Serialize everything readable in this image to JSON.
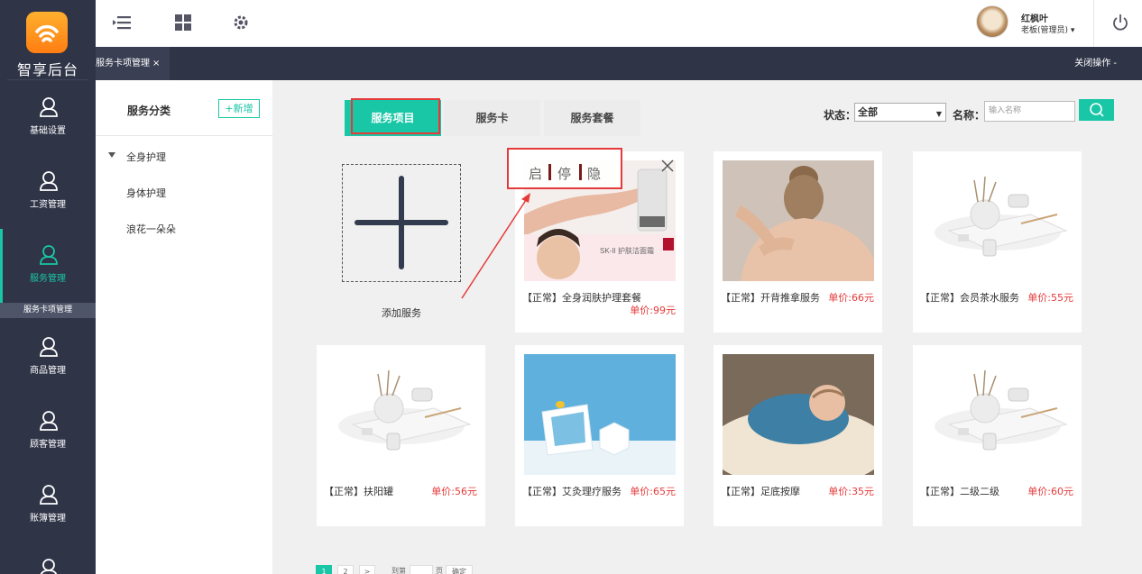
{
  "app": {
    "logo_text": "智享后台"
  },
  "nav": {
    "items": [
      {
        "label": "基础设置"
      },
      {
        "label": "工资管理"
      },
      {
        "label": "服务管理"
      },
      {
        "label": "商品管理"
      },
      {
        "label": "顾客管理"
      },
      {
        "label": "账簿管理"
      }
    ],
    "sub_label": "服务卡项管理"
  },
  "topbar": {
    "user_name": "红枫叶",
    "user_role": "老板(管理员) ▾"
  },
  "tabbar": {
    "tab_label": "服务卡项管理",
    "tab_close": "×",
    "close_ops": "关闭操作 -"
  },
  "category": {
    "title": "服务分类",
    "add_label": "+新增",
    "items": [
      "全身护理",
      "身体护理",
      "浪花一朵朵"
    ]
  },
  "tabs": [
    "服务项目",
    "服务卡",
    "服务套餐"
  ],
  "filters": {
    "status_label": "状态：",
    "status_value": "全部",
    "name_label": "名称：",
    "name_placeholder": "输入名称"
  },
  "add_service_label": "添加服务",
  "overlay": {
    "enable": "启",
    "stop": "停",
    "hide": "隐"
  },
  "cards": [
    {
      "title": "【正常】全身润肤护理套餐",
      "price": "单价:99元"
    },
    {
      "title": "【正常】开背推拿服务",
      "price": "单价:66元"
    },
    {
      "title": "【正常】会员茶水服务",
      "price": "单价:55元"
    },
    {
      "title": "【正常】扶阳罐",
      "price": "单价:56元"
    },
    {
      "title": "【正常】艾灸理疗服务",
      "price": "单价:65元"
    },
    {
      "title": "【正常】足底按摩",
      "price": "单价:35元"
    },
    {
      "title": "【正常】二级二级",
      "price": "单价:60元"
    }
  ],
  "card1_overlay_text": {
    "brand": "SK-II 护肤洁面霜"
  },
  "pager": {
    "pages": [
      "1",
      "2",
      ">"
    ],
    "goto_prefix": "到第",
    "goto_suffix": "页",
    "confirm": "确定"
  },
  "colors": {
    "accent": "#19c6a6",
    "sidebar": "#2f3447",
    "price_red": "#e63a3a"
  }
}
